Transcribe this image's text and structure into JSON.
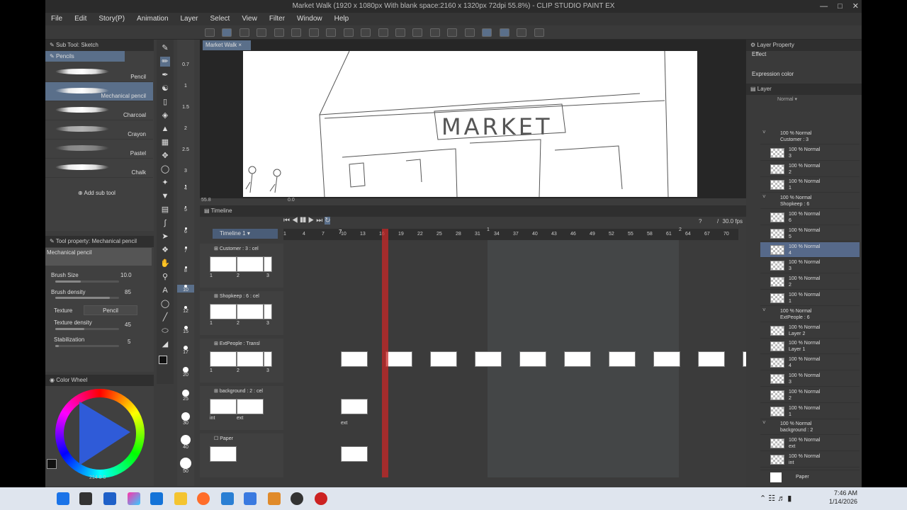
{
  "window": {
    "title": "Market Walk (1920 x 1080px With blank space:2160 x 1320px 72dpi 55.8%) - CLIP STUDIO PAINT EX"
  },
  "menu": [
    "File",
    "Edit",
    "Story(P)",
    "Animation",
    "Layer",
    "Select",
    "View",
    "Filter",
    "Window",
    "Help"
  ],
  "subtool": {
    "header": "Sub Tool: Sketch",
    "group": "Pencils",
    "brushes": [
      "Pencil",
      "Mechanical pencil",
      "Charcoal",
      "Crayon",
      "Pastel",
      "Chalk"
    ],
    "add_label": "Add sub tool"
  },
  "toolprop": {
    "header": "Tool property: Mechanical pencil",
    "name": "Mechanical pencil",
    "brush_size_label": "Brush Size",
    "brush_size": "10.0",
    "brush_density_label": "Brush density",
    "brush_density": "85",
    "texture_label": "Texture",
    "texture_value": "Pencil",
    "texture_density_label": "Texture density",
    "texture_density": "45",
    "stabilization_label": "Stabilization",
    "stabilization": "5"
  },
  "colorwheel": {
    "header": "Color Wheel",
    "footer": "214  0  0"
  },
  "brush_sizes": [
    "0.7",
    "1",
    "1.5",
    "2",
    "2.5",
    "3",
    "4",
    "5",
    "6",
    "7",
    "8",
    "10",
    "12",
    "15",
    "17",
    "20",
    "25",
    "30",
    "40",
    "50"
  ],
  "canvas": {
    "tab": "Market Walk",
    "zoom": "55.8",
    "rotate": "0.0",
    "sign": "MARKET"
  },
  "timeline": {
    "header": "Timeline",
    "name": "Timeline 1",
    "fps": "30.0 fps",
    "current_frame": "7",
    "q1": "?",
    "slash": "/",
    "slash2": "/",
    "frame_numbers": [
      "1",
      "4",
      "7",
      "10",
      "13",
      "16",
      "19",
      "22",
      "25",
      "28",
      "31",
      "34",
      "37",
      "40",
      "43",
      "46",
      "49",
      "52",
      "55",
      "58",
      "61",
      "64",
      "67",
      "70"
    ],
    "section_marks": [
      "1",
      "2"
    ],
    "tracks": [
      {
        "name": "Customer : 3 : cel",
        "cels": [
          "1",
          "2",
          "3"
        ]
      },
      {
        "name": "Shopkeep : 6 : cel",
        "cels": [
          "1",
          "2",
          "3"
        ]
      },
      {
        "name": "ExtPeople : Transl",
        "cels": [
          "1",
          "2",
          "3"
        ]
      },
      {
        "name": "background : 2 : cel",
        "cels": [
          "int",
          "ext"
        ]
      },
      {
        "name": "Paper",
        "cels": []
      }
    ],
    "bg_cel_label": "ext"
  },
  "rightpanel": {
    "layer_property": "Layer Property",
    "effect": "Effect",
    "expression_color": "Expression color",
    "layer_header": "Layer",
    "blend": "Normal",
    "layers": [
      {
        "folder": true,
        "mode": "100 % Normal",
        "name": "Customer : 3"
      },
      {
        "mode": "100 % Normal",
        "name": "3"
      },
      {
        "mode": "100 % Normal",
        "name": "2"
      },
      {
        "mode": "100 % Normal",
        "name": "1"
      },
      {
        "folder": true,
        "mode": "100 % Normal",
        "name": "Shopkeep : 6"
      },
      {
        "mode": "100 % Normal",
        "name": "6"
      },
      {
        "mode": "100 % Normal",
        "name": "5"
      },
      {
        "mode": "100 % Normal",
        "name": "4",
        "active": true
      },
      {
        "mode": "100 % Normal",
        "name": "3"
      },
      {
        "mode": "100 % Normal",
        "name": "2"
      },
      {
        "mode": "100 % Normal",
        "name": "1"
      },
      {
        "folder": true,
        "mode": "100 % Normal",
        "name": "ExtPeople : 6"
      },
      {
        "mode": "100 % Normal",
        "name": "Layer 2"
      },
      {
        "mode": "100 % Normal",
        "name": "Layer 1"
      },
      {
        "mode": "100 % Normal",
        "name": "4"
      },
      {
        "mode": "100 % Normal",
        "name": "3"
      },
      {
        "mode": "100 % Normal",
        "name": "2"
      },
      {
        "mode": "100 % Normal",
        "name": "1"
      },
      {
        "folder": true,
        "mode": "100 % Normal",
        "name": "background : 2"
      },
      {
        "mode": "100 % Normal",
        "name": "ext"
      },
      {
        "mode": "100 % Normal",
        "name": "int"
      }
    ],
    "paper": "Paper"
  },
  "taskbar": {
    "time": "7:46 AM",
    "date": "1/14/2026"
  }
}
